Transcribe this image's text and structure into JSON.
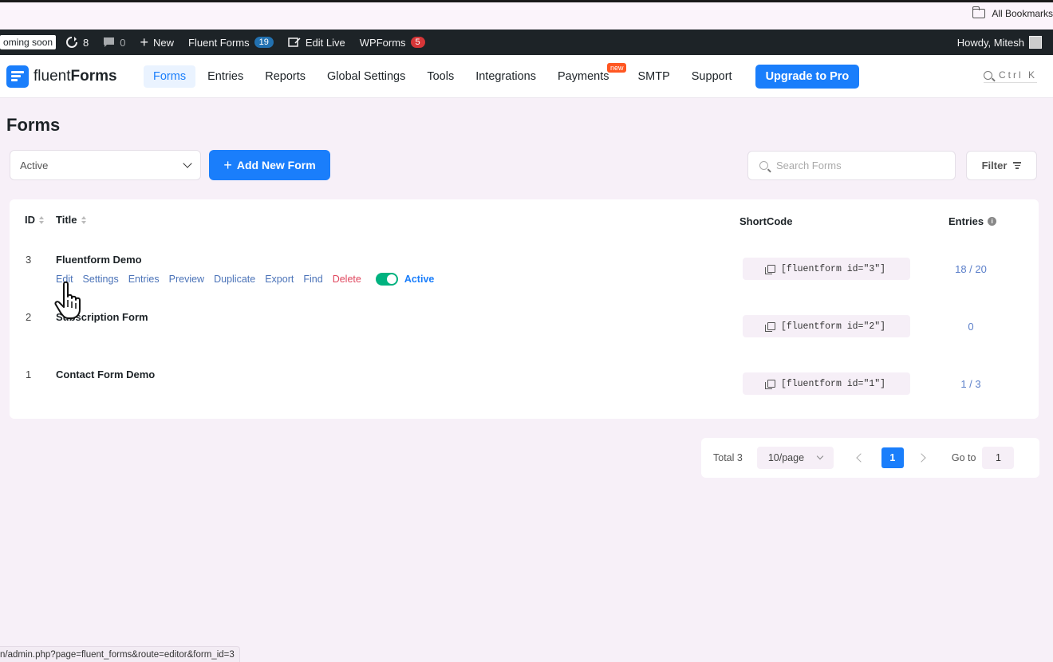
{
  "browser": {
    "bookmarks_label": "All Bookmarks"
  },
  "adminbar": {
    "coming_soon": "oming soon",
    "updates_count": "8",
    "comments_count": "0",
    "new_label": "New",
    "fluent_forms_label": "Fluent Forms",
    "fluent_forms_badge": "19",
    "edit_live_label": "Edit Live",
    "wpforms_label": "WPForms",
    "wpforms_badge": "5",
    "howdy": "Howdy, Mitesh"
  },
  "plugin_nav": {
    "logo_light": "fluent",
    "logo_bold": "Forms",
    "items": [
      {
        "label": "Forms",
        "active": true
      },
      {
        "label": "Entries"
      },
      {
        "label": "Reports"
      },
      {
        "label": "Global Settings"
      },
      {
        "label": "Tools"
      },
      {
        "label": "Integrations"
      },
      {
        "label": "Payments",
        "badge": "new"
      },
      {
        "label": "SMTP"
      },
      {
        "label": "Support"
      }
    ],
    "upgrade_label": "Upgrade to Pro",
    "search_shortcut": "Ctrl K"
  },
  "page": {
    "title": "Forms",
    "status_select": "Active",
    "add_button": "Add New Form",
    "search_placeholder": "Search Forms",
    "filter_label": "Filter"
  },
  "table": {
    "headers": {
      "id": "ID",
      "title": "Title",
      "shortcode": "ShortCode",
      "entries": "Entries"
    },
    "actions": [
      "Edit",
      "Settings",
      "Entries",
      "Preview",
      "Duplicate",
      "Export",
      "Find",
      "Delete"
    ],
    "active_label": "Active",
    "rows": [
      {
        "id": "3",
        "title": "Fluentform Demo",
        "shortcode": "[fluentform id=\"3\"]",
        "entries": "18 / 20"
      },
      {
        "id": "2",
        "title": "Subscription Form",
        "shortcode": "[fluentform id=\"2\"]",
        "entries": "0"
      },
      {
        "id": "1",
        "title": "Contact Form Demo",
        "shortcode": "[fluentform id=\"1\"]",
        "entries": "1 / 3"
      }
    ]
  },
  "pagination": {
    "total": "Total 3",
    "page_size": "10/page",
    "current": "1",
    "goto_label": "Go to",
    "goto_value": "1"
  },
  "statusbar": {
    "url": "n/admin.php?page=fluent_forms&route=editor&form_id=3"
  }
}
